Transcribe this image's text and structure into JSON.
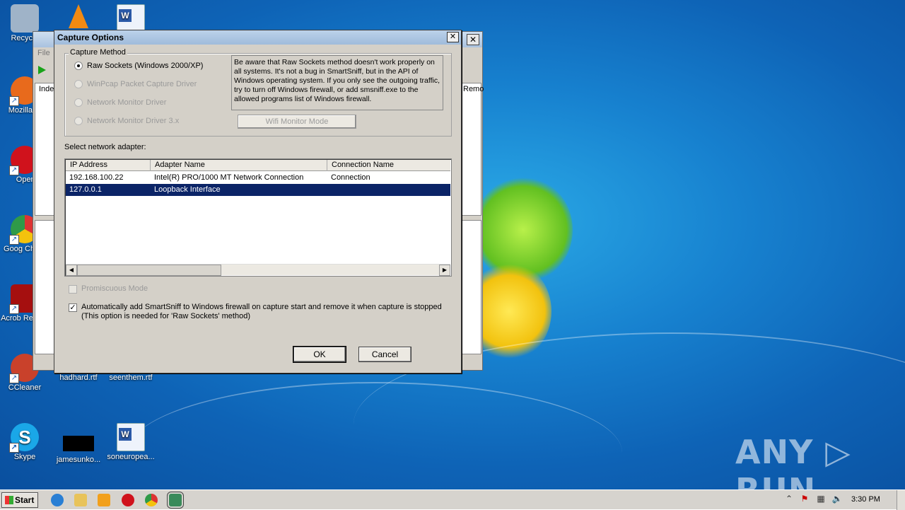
{
  "desktop": {
    "icons": [
      {
        "label": "Recycle",
        "icon": "recycle-bin-icon",
        "color": "#9fb3c8"
      },
      {
        "label": "Mozilla Fi",
        "icon": "firefox-icon",
        "color": "#e86a1c"
      },
      {
        "label": "Oper",
        "icon": "opera-icon",
        "color": "#d0121c"
      },
      {
        "label": "Goog Chron",
        "icon": "chrome-icon",
        "color": "#2f9a48"
      },
      {
        "label": "Acrob Reader",
        "icon": "acrobat-icon",
        "color": "#a50f0f"
      },
      {
        "label": "CCleaner",
        "icon": "ccleaner-icon",
        "color": "#c9412b"
      },
      {
        "label": "Skype",
        "icon": "skype-icon",
        "color": "#1aa7e8"
      },
      {
        "label": "hadhard.rtf",
        "icon": "rtf-file-icon",
        "color": "#eef3fb"
      },
      {
        "label": "seenthem.rtf",
        "icon": "rtf-file-icon",
        "color": "#eef3fb"
      },
      {
        "label": "jamesunko...",
        "icon": "black-file-icon",
        "color": "#000000"
      },
      {
        "label": "soneuropea...",
        "icon": "word-file-icon",
        "color": "#eef3fb"
      }
    ],
    "watermark": "ANY ▷ RUN"
  },
  "app": {
    "menu_file": "File",
    "col_index": "Inde",
    "col_remote": "Remo"
  },
  "dialog": {
    "title": "Capture Options",
    "close": "✕",
    "capture_method_label": "Capture Method",
    "methods": [
      {
        "label": "Raw Sockets (Windows 2000/XP)",
        "selected": true,
        "enabled": true
      },
      {
        "label": "WinPcap Packet Capture Driver",
        "selected": false,
        "enabled": false
      },
      {
        "label": "Network Monitor Driver",
        "selected": false,
        "enabled": false
      },
      {
        "label": "Network Monitor Driver 3.x",
        "selected": false,
        "enabled": false
      }
    ],
    "note": "Be aware that Raw Sockets method doesn't work properly on all systems. It's not a bug in SmartSniff, but in the API of Windows operating system. If you only see the outgoing traffic, try to turn off Windows firewall, or add smsniff.exe to the allowed programs list of Windows firewall.",
    "wifi_button": "Wifi Monitor Mode",
    "adapter_label": "Select network adapter:",
    "columns": [
      "IP Address",
      "Adapter Name",
      "Connection Name"
    ],
    "adapters": [
      {
        "ip": "192.168.100.22",
        "name": "Intel(R) PRO/1000 MT Network Connection",
        "connection": "Connection",
        "selected": false
      },
      {
        "ip": "127.0.0.1",
        "name": "Loopback Interface",
        "connection": "",
        "selected": true
      }
    ],
    "promiscuous": {
      "label": "Promiscuous Mode",
      "checked": false,
      "enabled": false
    },
    "firewall": {
      "line1": "Automatically add SmartSniff to Windows firewall on capture start and remove it when capture is stopped",
      "line2": "(This option is needed for 'Raw Sockets' method)",
      "checked": true
    },
    "ok": "OK",
    "cancel": "Cancel"
  },
  "taskbar": {
    "start": "Start",
    "clock": "3:30 PM",
    "tray_up": "⌃"
  }
}
